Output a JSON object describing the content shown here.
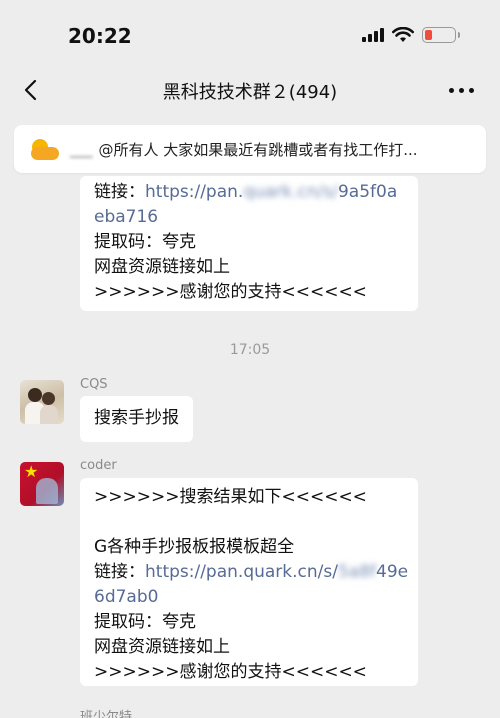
{
  "status_bar": {
    "time": "20:22"
  },
  "header": {
    "title": "黑科技技术群２(494)"
  },
  "notice": {
    "sender": "___",
    "text": "@所有人 大家如果最近有跳槽或者有找工作打..."
  },
  "chat": {
    "messages": [
      {
        "type": "text",
        "lines": [
          {
            "prefix": "链接：",
            "link": "https://pan.",
            "blurred": "quark.cn/s/",
            "link_end": "9a5f0a"
          },
          {
            "text": "eba716"
          },
          {
            "text": "提取码：夸克"
          },
          {
            "text": "网盘资源链接如上"
          },
          {
            "text": ">>>>>>感谢您的支持<<<<<<"
          }
        ]
      },
      {
        "type": "timestamp",
        "text": "17:05"
      },
      {
        "type": "text",
        "sender": "CQS",
        "text": "搜索手抄报"
      },
      {
        "type": "text",
        "sender": "coder",
        "lines": [
          {
            "text": ">>>>>>搜索结果如下<<<<<<"
          },
          {
            "text": ""
          },
          {
            "text": "G各种手抄报板报模板超全"
          },
          {
            "prefix": "链接：",
            "link": "https://pan.quark.cn/s/",
            "blurred": "5a8f",
            "link_end": "49e"
          },
          {
            "text": "6d7ab0"
          },
          {
            "text": "提取码：夸克"
          },
          {
            "text": "网盘资源链接如上"
          },
          {
            "text": ">>>>>>感谢您的支持<<<<<<"
          }
        ]
      },
      {
        "type": "partial",
        "sender": "班少尔特"
      }
    ]
  }
}
